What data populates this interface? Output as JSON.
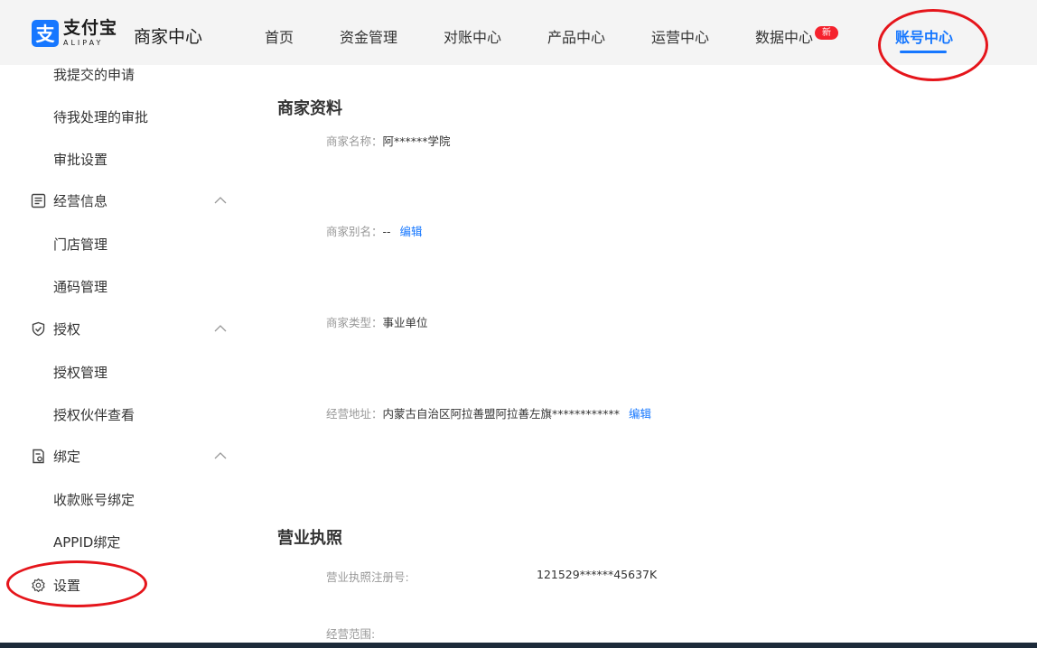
{
  "logo": {
    "mark": "支",
    "cn": "支付宝",
    "en": "ALIPAY"
  },
  "app_title": "商家中心",
  "nav": [
    {
      "label": "首页"
    },
    {
      "label": "资金管理"
    },
    {
      "label": "对账中心"
    },
    {
      "label": "产品中心"
    },
    {
      "label": "运营中心"
    },
    {
      "label": "数据中心",
      "badge": "新"
    },
    {
      "label": "账号中心",
      "active": true
    }
  ],
  "sidebar": {
    "top_items": [
      "我提交的申请",
      "待我处理的审批",
      "审批设置"
    ],
    "groups": [
      {
        "label": "经营信息",
        "icon": "document-list-icon",
        "items": [
          "门店管理",
          "通码管理"
        ]
      },
      {
        "label": "授权",
        "icon": "shield-check-icon",
        "items": [
          "授权管理",
          "授权伙伴查看"
        ]
      },
      {
        "label": "绑定",
        "icon": "bind-document-icon",
        "items": [
          "收款账号绑定",
          "APPID绑定"
        ]
      }
    ],
    "settings": {
      "label": "设置",
      "icon": "gear-icon"
    }
  },
  "merchant_profile": {
    "title": "商家资料",
    "name_label": "商家名称：",
    "name_value": "阿******学院",
    "alias_label": "商家别名：",
    "alias_value": "--",
    "alias_edit": "编辑",
    "type_label": "商家类型：",
    "type_value": "事业单位",
    "address_label": "经营地址：",
    "address_value": "内蒙古自治区阿拉善盟阿拉善左旗************",
    "address_edit": "编辑"
  },
  "business_license": {
    "title": "营业执照",
    "reg_no_label": "营业执照注册号:",
    "reg_no_value": "121529******45637K",
    "scope_label": "经营范围:"
  },
  "colors": {
    "accent": "#1677ff",
    "badge": "#f5222d",
    "annotation": "#e5151b"
  }
}
